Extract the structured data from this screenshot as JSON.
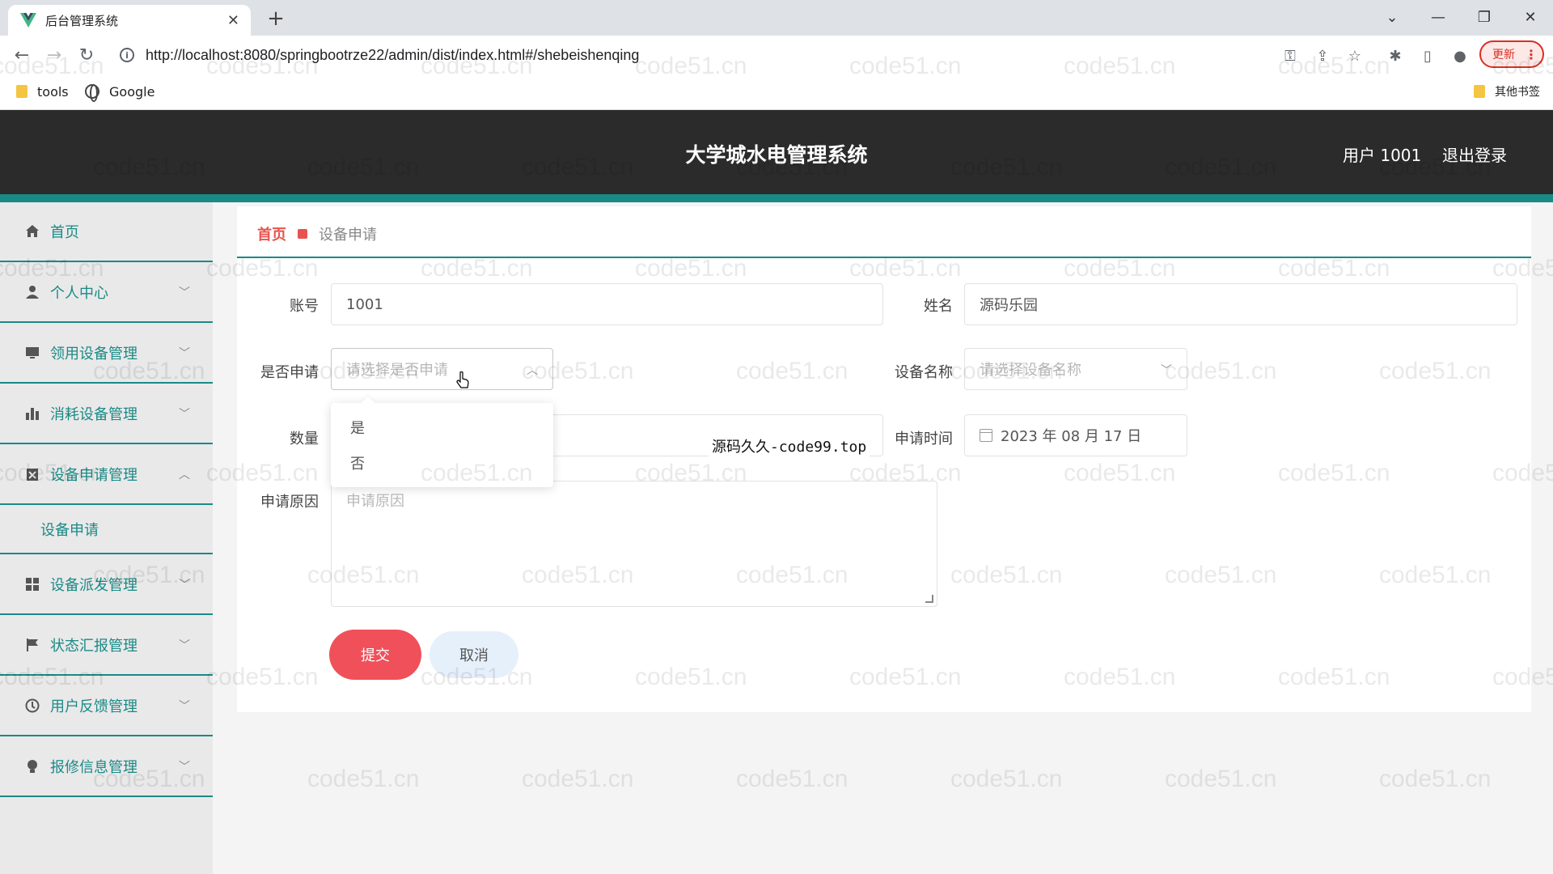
{
  "browser": {
    "tab_title": "后台管理系统",
    "url": "http://localhost:8080/springbootrze22/admin/dist/index.html#/shebeishenqing",
    "update_label": "更新",
    "bookmarks": [
      {
        "label": "tools",
        "icon": "folder-icon"
      },
      {
        "label": "Google",
        "icon": "globe-icon"
      }
    ],
    "other_bookmarks": "其他书签"
  },
  "header": {
    "title": "大学城水电管理系统",
    "user": "用户 1001",
    "logout": "退出登录"
  },
  "sidebar": {
    "items": [
      {
        "label": "首页",
        "icon": "home-icon"
      },
      {
        "label": "个人中心",
        "icon": "user-icon"
      },
      {
        "label": "领用设备管理",
        "icon": "monitor-icon"
      },
      {
        "label": "消耗设备管理",
        "icon": "bar-chart-icon"
      },
      {
        "label": "设备申请管理",
        "icon": "trash-icon"
      },
      {
        "label": "设备派发管理",
        "icon": "grid-icon"
      },
      {
        "label": "状态汇报管理",
        "icon": "flag-icon"
      },
      {
        "label": "用户反馈管理",
        "icon": "feedback-icon"
      },
      {
        "label": "报修信息管理",
        "icon": "bulb-icon"
      }
    ],
    "submenu": {
      "label": "设备申请"
    }
  },
  "breadcrumb": {
    "home": "首页",
    "current": "设备申请"
  },
  "form": {
    "account": {
      "label": "账号",
      "value": "1001"
    },
    "name": {
      "label": "姓名",
      "value": "源码乐园"
    },
    "apply": {
      "label": "是否申请",
      "placeholder": "请选择是否申请",
      "options": [
        "是",
        "否"
      ]
    },
    "device": {
      "label": "设备名称",
      "placeholder": "请选择设备名称"
    },
    "quantity": {
      "label": "数量"
    },
    "apply_time": {
      "label": "申请时间",
      "value": "2023 年 08 月 17 日"
    },
    "reason": {
      "label": "申请原因",
      "placeholder": "申请原因"
    },
    "submit": "提交",
    "cancel": "取消"
  },
  "overlay_text": "源码久久-code99.top",
  "watermark": "code51.cn",
  "colors": {
    "accent": "#1a8a86",
    "header_bg": "#2b2b2b",
    "primary_button": "#f0505a",
    "breadcrumb_home": "#e8534d"
  }
}
